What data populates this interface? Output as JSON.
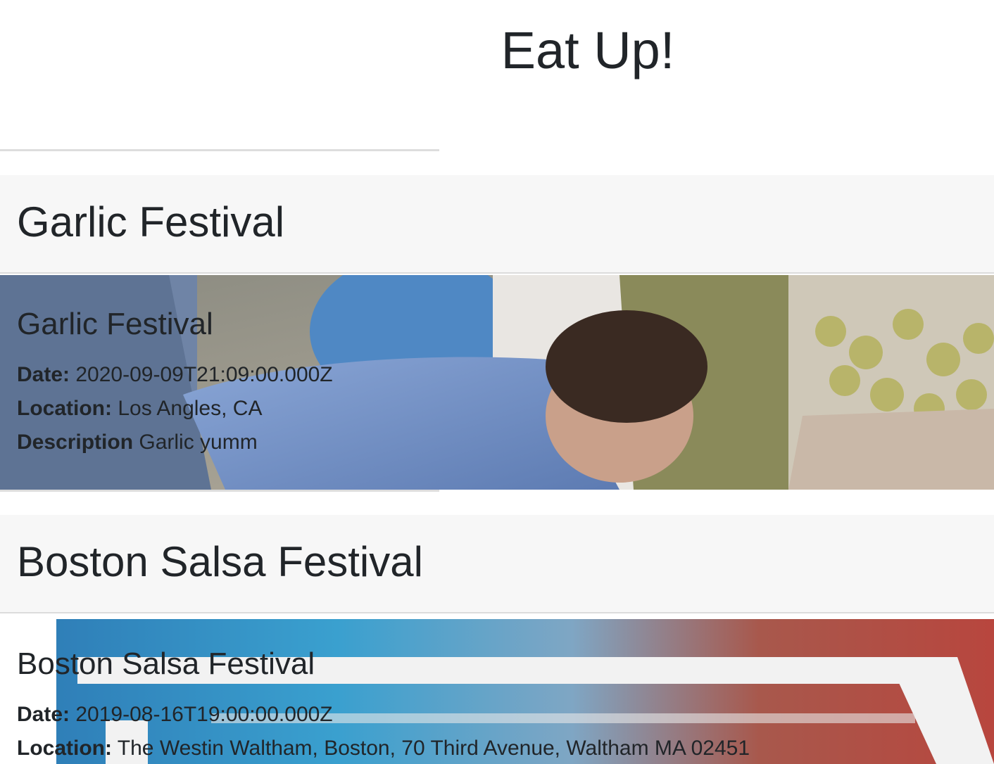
{
  "header": {
    "title": "Eat Up!"
  },
  "events": [
    {
      "header_title": "Garlic Festival",
      "body_title": "Garlic Festival",
      "date_label": "Date:",
      "date": "2020-09-09T21:09:00.000Z",
      "location_label": "Location:",
      "location": "Los Angles, CA",
      "description_label": "Description",
      "description": "Garlic yumm"
    },
    {
      "header_title": "Boston Salsa Festival",
      "body_title": "Boston Salsa Festival",
      "date_label": "Date:",
      "date": "2019-08-16T19:00:00.000Z",
      "location_label": "Location:",
      "location": "The Westin Waltham, Boston, 70 Third Avenue, Waltham MA 02451"
    }
  ]
}
